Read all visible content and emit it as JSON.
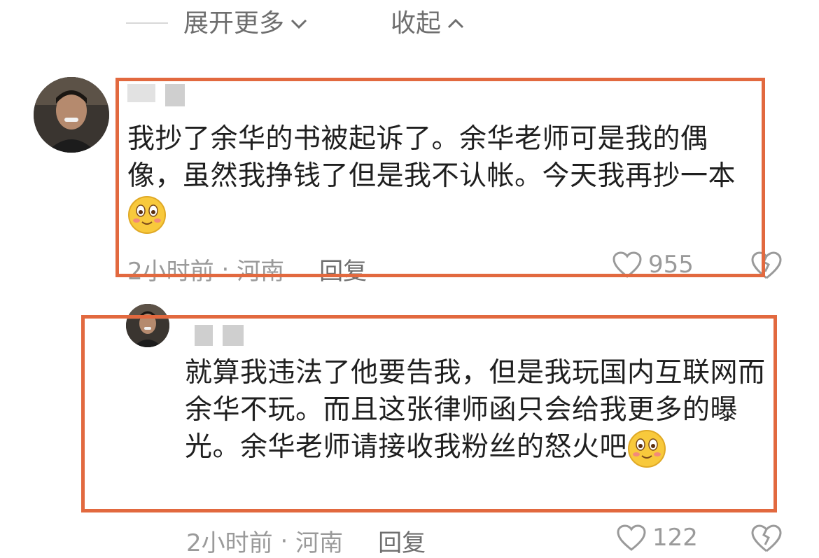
{
  "top_actions": {
    "expand_label": "展开更多",
    "collapse_label": "收起"
  },
  "comments": [
    {
      "text": "我抄了余华的书被起诉了。余华老师可是我的偶像，虽然我挣钱了但是我不认帐。今天我再抄一本",
      "emoji": "blushing-face-icon",
      "time": "2小时前",
      "location": "河南",
      "reply_label": "回复",
      "likes": "955"
    },
    {
      "text": "就算我违法了他要告我，但是我玩国内互联网而余华不玩。而且这张律师函只会给我更多的曝光。余华老师请接收我粉丝的怒火吧",
      "emoji": "blushing-face-icon",
      "time": "2小时前",
      "location": "河南",
      "reply_label": "回复",
      "likes": "122"
    }
  ],
  "colors": {
    "highlight": "#e2693f",
    "muted_text": "#9a9a9a"
  }
}
